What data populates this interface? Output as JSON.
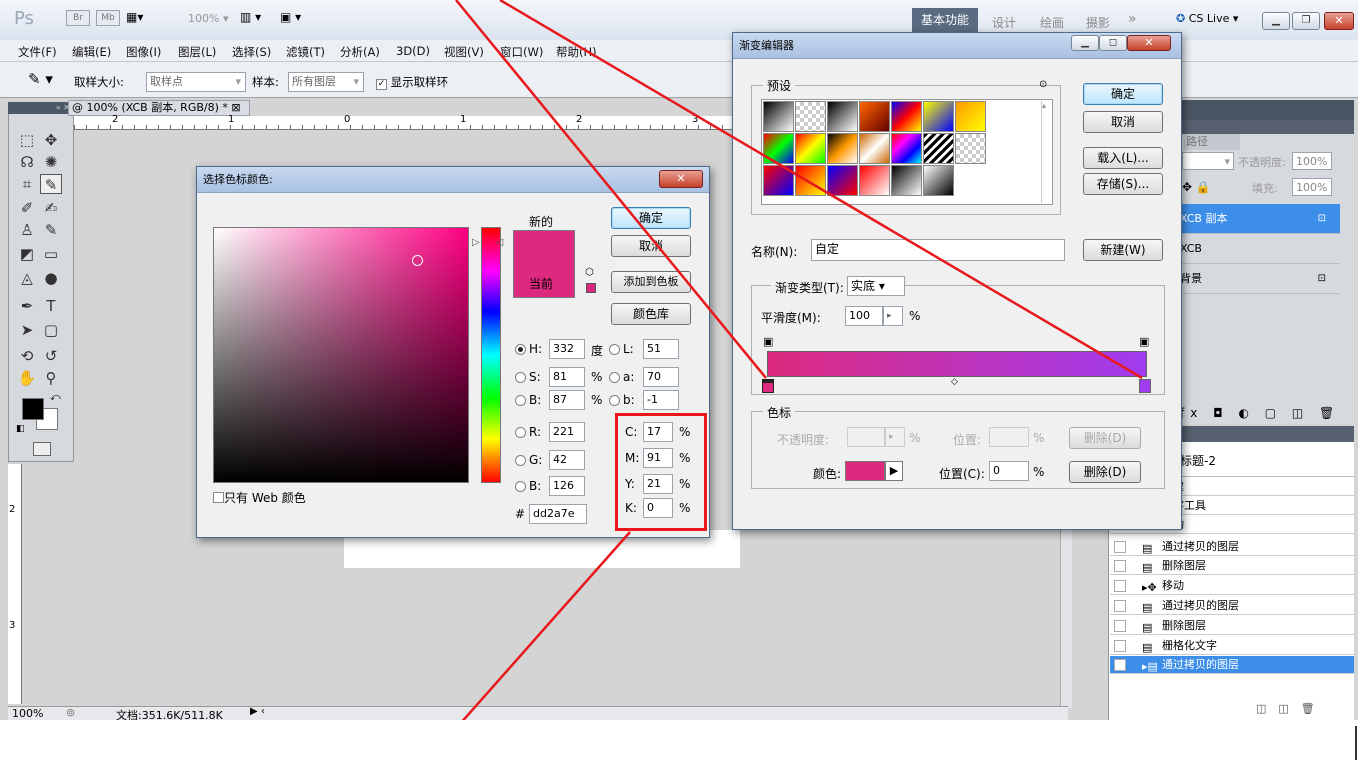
{
  "app": {
    "logo": "Ps",
    "zoom_menu": "100%",
    "workspaces": [
      "基本功能",
      "设计",
      "绘画",
      "摄影"
    ],
    "more": "»",
    "cs_live": "CS Live"
  },
  "menu": [
    "文件(F)",
    "编辑(E)",
    "图像(I)",
    "图层(L)",
    "选择(S)",
    "滤镜(T)",
    "分析(A)",
    "3D(D)",
    "视图(V)",
    "窗口(W)",
    "帮助(H)"
  ],
  "options": {
    "sample_size_label": "取样大小:",
    "sample_size_value": "取样点",
    "sample_label": "样本:",
    "sample_value": "所有图层",
    "show_ring": "显示取样环"
  },
  "document": {
    "tab": "@ 100% (XCB 副本, RGB/8) *",
    "ruler_ticks": [
      "2",
      "1",
      "0",
      "1",
      "2",
      "3"
    ],
    "vruler": [
      "2",
      "3"
    ],
    "zoom": "100%",
    "status": "文档:351.6K/511.8K"
  },
  "color_picker": {
    "title": "选择色标颜色:",
    "new_label": "新的",
    "current_label": "当前",
    "new_color": "#dd2a7e",
    "current_color": "#dd2a7e",
    "ok": "确定",
    "cancel": "取消",
    "add_swatch": "添加到色板",
    "libraries": "颜色库",
    "web_only": "只有 Web 颜色",
    "fields": {
      "H": "332",
      "S": "81",
      "B": "87",
      "R": "221",
      "G": "42",
      "Bv": "126",
      "L": "51",
      "a": "70",
      "b": "-1",
      "C": "17",
      "M": "91",
      "Y": "21",
      "K": "0"
    },
    "units": {
      "deg": "度",
      "pct": "%"
    },
    "hex": "dd2a7e",
    "labels": {
      "H": "H:",
      "S": "S:",
      "B": "B:",
      "R": "R:",
      "G": "G:",
      "Bv": "B:",
      "L": "L:",
      "a": "a:",
      "b": "b:",
      "C": "C:",
      "M": "M:",
      "Y": "Y:",
      "K": "K:",
      "hash": "#"
    }
  },
  "gradient_editor": {
    "title": "渐变编辑器",
    "presets_label": "预设",
    "ok": "确定",
    "cancel": "取消",
    "load": "载入(L)...",
    "save": "存储(S)...",
    "name_label": "名称(N):",
    "name_value": "自定",
    "new_button": "新建(W)",
    "type_label": "渐变类型(T):",
    "type_value": "实底",
    "smooth_label": "平滑度(M):",
    "smooth_value": "100",
    "smooth_unit": "%",
    "stops_label": "色标",
    "opacity_label": "不透明度:",
    "opacity_unit": "%",
    "location_label_disabled": "位置:",
    "location_unit": "%",
    "delete": "删除(D)",
    "color_label": "颜色:",
    "location_label": "位置(C):",
    "location_value": "0",
    "start_color": "#dd2a7e",
    "end_color": "#a03cf0"
  },
  "layers": {
    "tab": "路径",
    "opacity_label": "不透明度:",
    "opacity_value": "100%",
    "fill_label": "填充:",
    "fill_value": "100%",
    "rows": [
      "XCB 副本",
      "XCB",
      "背景"
    ]
  },
  "history": {
    "title": "未标题-2",
    "items": [
      "新建",
      "文字工具",
      "移动",
      "通过拷贝的图层",
      "删除图层",
      "移动",
      "通过拷贝的图层",
      "删除图层",
      "栅格化文字",
      "通过拷贝的图层"
    ]
  }
}
